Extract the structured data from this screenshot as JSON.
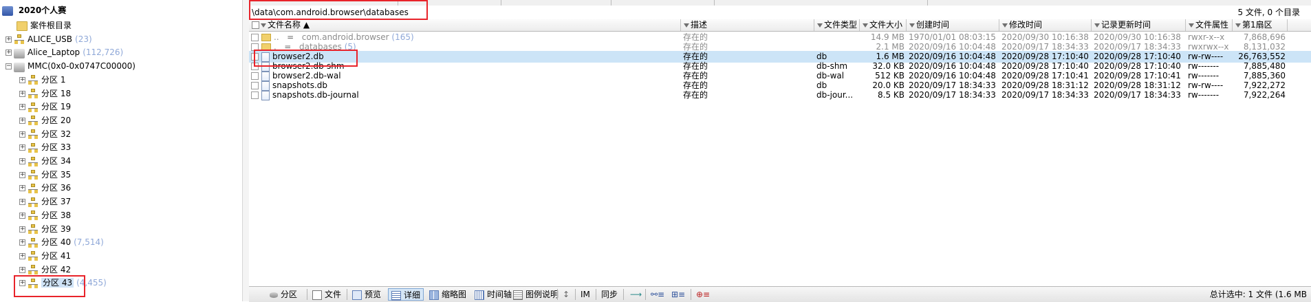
{
  "tree": {
    "root": "2020个人赛",
    "items": [
      {
        "label": "案件根目录",
        "count": ""
      },
      {
        "label": "ALICE_USB",
        "count": "(23)"
      },
      {
        "label": "Alice_Laptop",
        "count": "(112,726)"
      },
      {
        "label": "MMC(0x0-0x0747C00000)",
        "count": ""
      },
      {
        "label": "分区 1",
        "count": ""
      },
      {
        "label": "分区 18",
        "count": ""
      },
      {
        "label": "分区 19",
        "count": ""
      },
      {
        "label": "分区 20",
        "count": ""
      },
      {
        "label": "分区 32",
        "count": ""
      },
      {
        "label": "分区 33",
        "count": ""
      },
      {
        "label": "分区 34",
        "count": ""
      },
      {
        "label": "分区 35",
        "count": ""
      },
      {
        "label": "分区 36",
        "count": ""
      },
      {
        "label": "分区 37",
        "count": ""
      },
      {
        "label": "分区 38",
        "count": ""
      },
      {
        "label": "分区 39",
        "count": ""
      },
      {
        "label": "分区 40",
        "count": "(7,514)"
      },
      {
        "label": "分区 41",
        "count": ""
      },
      {
        "label": "分区 42",
        "count": ""
      },
      {
        "label": "分区 43",
        "count": "(4,455)"
      }
    ]
  },
  "pathbar": {
    "path": "\\data\\com.android.browser\\databases",
    "file_count": "5 文件, 0 个目录"
  },
  "grid": {
    "headers": {
      "name": "文件名称",
      "desc": "描述",
      "type": "文件类型",
      "size": "文件大小",
      "created": "创建时间",
      "modified": "修改时间",
      "record": "记录更新时间",
      "attr": "文件属性",
      "sector": "第1扇区"
    },
    "rows": [
      {
        "name": "..",
        "sub": "com.android.browser",
        "subcount": "(165)",
        "desc": "存在的",
        "type": "",
        "size": "14.9 MB",
        "c_date": "1970/01/01",
        "c_time": "08:03:15",
        "m_date": "2020/09/30",
        "m_time": "10:16:38",
        "r_date": "2020/09/30",
        "r_time": "10:16:38",
        "attr": "rwxr-x--x",
        "sector": "7,868,696"
      },
      {
        "name": ".",
        "sub": "databases",
        "subcount": "(5)",
        "desc": "存在的",
        "type": "",
        "size": "2.1 MB",
        "c_date": "2020/09/16",
        "c_time": "10:04:48",
        "m_date": "2020/09/17",
        "m_time": "18:34:33",
        "r_date": "2020/09/17",
        "r_time": "18:34:33",
        "attr": "rwxrwx--x",
        "sector": "8,131,032"
      },
      {
        "name": "browser2.db",
        "desc": "存在的",
        "type": "db",
        "size": "1.6 MB",
        "c_date": "2020/09/16",
        "c_time": "10:04:48",
        "m_date": "2020/09/28",
        "m_time": "17:10:40",
        "r_date": "2020/09/28",
        "r_time": "17:10:40",
        "attr": "rw-rw----",
        "sector": "26,763,552"
      },
      {
        "name": "browser2.db-shm",
        "desc": "存在的",
        "type": "db-shm",
        "size": "32.0 KB",
        "c_date": "2020/09/16",
        "c_time": "10:04:48",
        "m_date": "2020/09/28",
        "m_time": "17:10:40",
        "r_date": "2020/09/28",
        "r_time": "17:10:40",
        "attr": "rw-------",
        "sector": "7,885,480"
      },
      {
        "name": "browser2.db-wal",
        "desc": "存在的",
        "type": "db-wal",
        "size": "512 KB",
        "c_date": "2020/09/16",
        "c_time": "10:04:48",
        "m_date": "2020/09/28",
        "m_time": "17:10:41",
        "r_date": "2020/09/28",
        "r_time": "17:10:41",
        "attr": "rw-------",
        "sector": "7,885,360"
      },
      {
        "name": "snapshots.db",
        "desc": "存在的",
        "type": "db",
        "size": "20.0 KB",
        "c_date": "2020/09/17",
        "c_time": "18:34:33",
        "m_date": "2020/09/28",
        "m_time": "18:31:12",
        "r_date": "2020/09/28",
        "r_time": "18:31:12",
        "attr": "rw-rw----",
        "sector": "7,922,272"
      },
      {
        "name": "snapshots.db-journal",
        "desc": "存在的",
        "type": "db-jour...",
        "size": "8.5 KB",
        "c_date": "2020/09/17",
        "c_time": "18:34:33",
        "m_date": "2020/09/17",
        "m_time": "18:34:33",
        "r_date": "2020/09/17",
        "r_time": "18:34:33",
        "attr": "rw-------",
        "sector": "7,922,264"
      }
    ]
  },
  "toolbar": {
    "partition": "分区",
    "file": "文件",
    "preview": "预览",
    "detail": "详细",
    "thumbnail": "缩略图",
    "timeline": "时间轴",
    "legend": "图例说明",
    "im": "IM",
    "sync": "同步",
    "status": "总计选中: 1 文件 (1.6 MB"
  },
  "colors": {
    "selection": "#cce4f7",
    "highlight_box": "#e8232a",
    "count_text": "#8fa8d8"
  }
}
